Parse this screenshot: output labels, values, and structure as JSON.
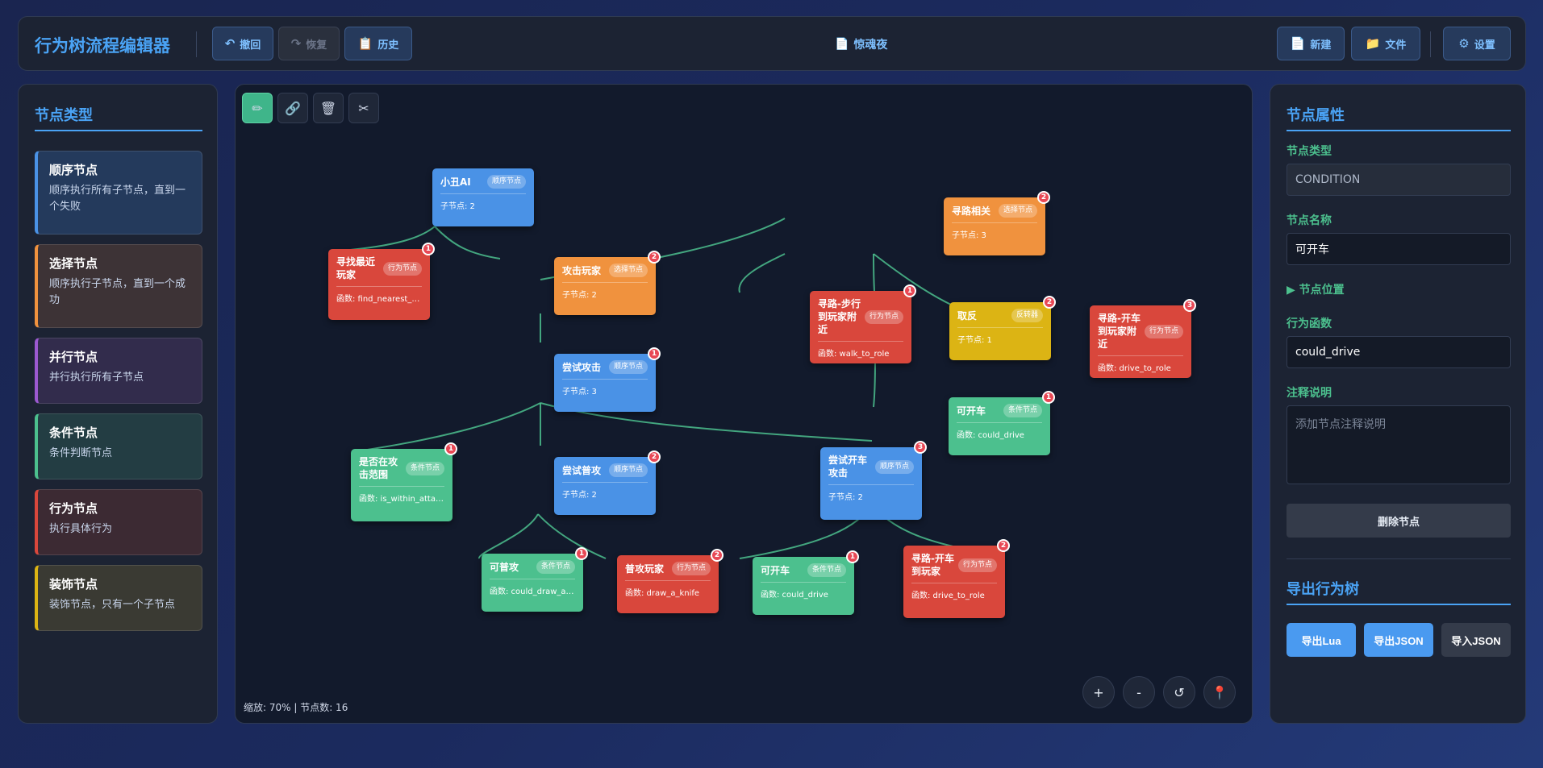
{
  "header": {
    "app_title": "行为树流程编辑器",
    "undo": {
      "icon": "↶",
      "label": "撤回"
    },
    "redo": {
      "icon": "↷",
      "label": "恢复"
    },
    "history": {
      "icon": "📋",
      "label": "历史"
    },
    "doc": {
      "icon": "📄",
      "title": "惊魂夜"
    },
    "new": {
      "icon": "📄",
      "label": "新建"
    },
    "file": {
      "icon": "📁",
      "label": "文件"
    },
    "settings": {
      "icon": "⚙",
      "label": "设置"
    }
  },
  "sidebar": {
    "title": "节点类型",
    "types": [
      {
        "title": "顺序节点",
        "desc": "顺序执行所有子节点，直到一个失败"
      },
      {
        "title": "选择节点",
        "desc": "顺序执行子节点，直到一个成功"
      },
      {
        "title": "并行节点",
        "desc": "并行执行所有子节点"
      },
      {
        "title": "条件节点",
        "desc": "条件判断节点"
      },
      {
        "title": "行为节点",
        "desc": "执行具体行为"
      },
      {
        "title": "装饰节点",
        "desc": "装饰节点，只有一个子节点"
      }
    ]
  },
  "toolbar": {
    "pencil": "✏",
    "link": "🔗",
    "trash": "🗑",
    "scissors": "✂"
  },
  "canvas": {
    "status": "缩放: 70% | 节点数: 16",
    "zoom_in": "+",
    "zoom_out": "-",
    "reset": "↺",
    "locate": "📍",
    "nodes": {
      "root": {
        "title": "小丑AI",
        "tag": "顺序节点",
        "info": "子节点: 2"
      },
      "find": {
        "title": "寻找最近玩家",
        "tag": "行为节点",
        "info": "函数: find_nearest_role",
        "badge": "1"
      },
      "attack": {
        "title": "攻击玩家",
        "tag": "选择节点",
        "info": "子节点: 2",
        "badge": "2"
      },
      "path": {
        "title": "寻路相关",
        "tag": "选择节点",
        "info": "子节点: 3",
        "badge": "2"
      },
      "try_attack": {
        "title": "尝试攻击",
        "tag": "顺序节点",
        "info": "子节点: 3",
        "badge": "1"
      },
      "walk": {
        "title": "寻路-步行到玩家附近",
        "tag": "行为节点",
        "info": "函数: walk_to_role",
        "badge": "1"
      },
      "invert": {
        "title": "取反",
        "tag": "反转器",
        "info": "子节点: 1",
        "badge": "2"
      },
      "drive_near": {
        "title": "寻路-开车到玩家附近",
        "tag": "行为节点",
        "info": "函数: drive_to_role",
        "badge": "3"
      },
      "can_drive_a": {
        "title": "可开车",
        "tag": "条件节点",
        "info": "函数: could_drive",
        "badge": "1"
      },
      "in_range": {
        "title": "是否在攻击范围",
        "tag": "条件节点",
        "info": "函数: is_within_attack...",
        "badge": "1"
      },
      "try_normal": {
        "title": "尝试普攻",
        "tag": "顺序节点",
        "info": "子节点: 2",
        "badge": "2"
      },
      "try_drive": {
        "title": "尝试开车攻击",
        "tag": "顺序节点",
        "info": "子节点: 2",
        "badge": "3"
      },
      "can_normal": {
        "title": "可普攻",
        "tag": "条件节点",
        "info": "函数: could_draw_a_k...",
        "badge": "1"
      },
      "normal_attack": {
        "title": "普攻玩家",
        "tag": "行为节点",
        "info": "函数: draw_a_knife",
        "badge": "2"
      },
      "can_drive_b": {
        "title": "可开车",
        "tag": "条件节点",
        "info": "函数: could_drive",
        "badge": "1"
      },
      "drive_to": {
        "title": "寻路-开车到玩家",
        "tag": "行为节点",
        "info": "函数: drive_to_role",
        "badge": "2"
      }
    }
  },
  "props": {
    "title": "节点属性",
    "type_label": "节点类型",
    "type_value": "CONDITION",
    "name_label": "节点名称",
    "name_value": "可开车",
    "position_label": "▶ 节点位置",
    "func_label": "行为函数",
    "func_value": "could_drive",
    "note_label": "注释说明",
    "note_placeholder": "添加节点注释说明",
    "delete": "删除节点",
    "export_title": "导出行为树",
    "export_lua": "导出Lua",
    "export_json": "导出JSON",
    "import_json": "导入JSON"
  },
  "colors": {
    "accent": "#4aa3f5",
    "sequence": "#4a92e6",
    "selector": "#f0923e",
    "action": "#d9473c",
    "condition": "#4cc08e",
    "decorator": "#dcb414",
    "edge": "#4cc08e"
  }
}
